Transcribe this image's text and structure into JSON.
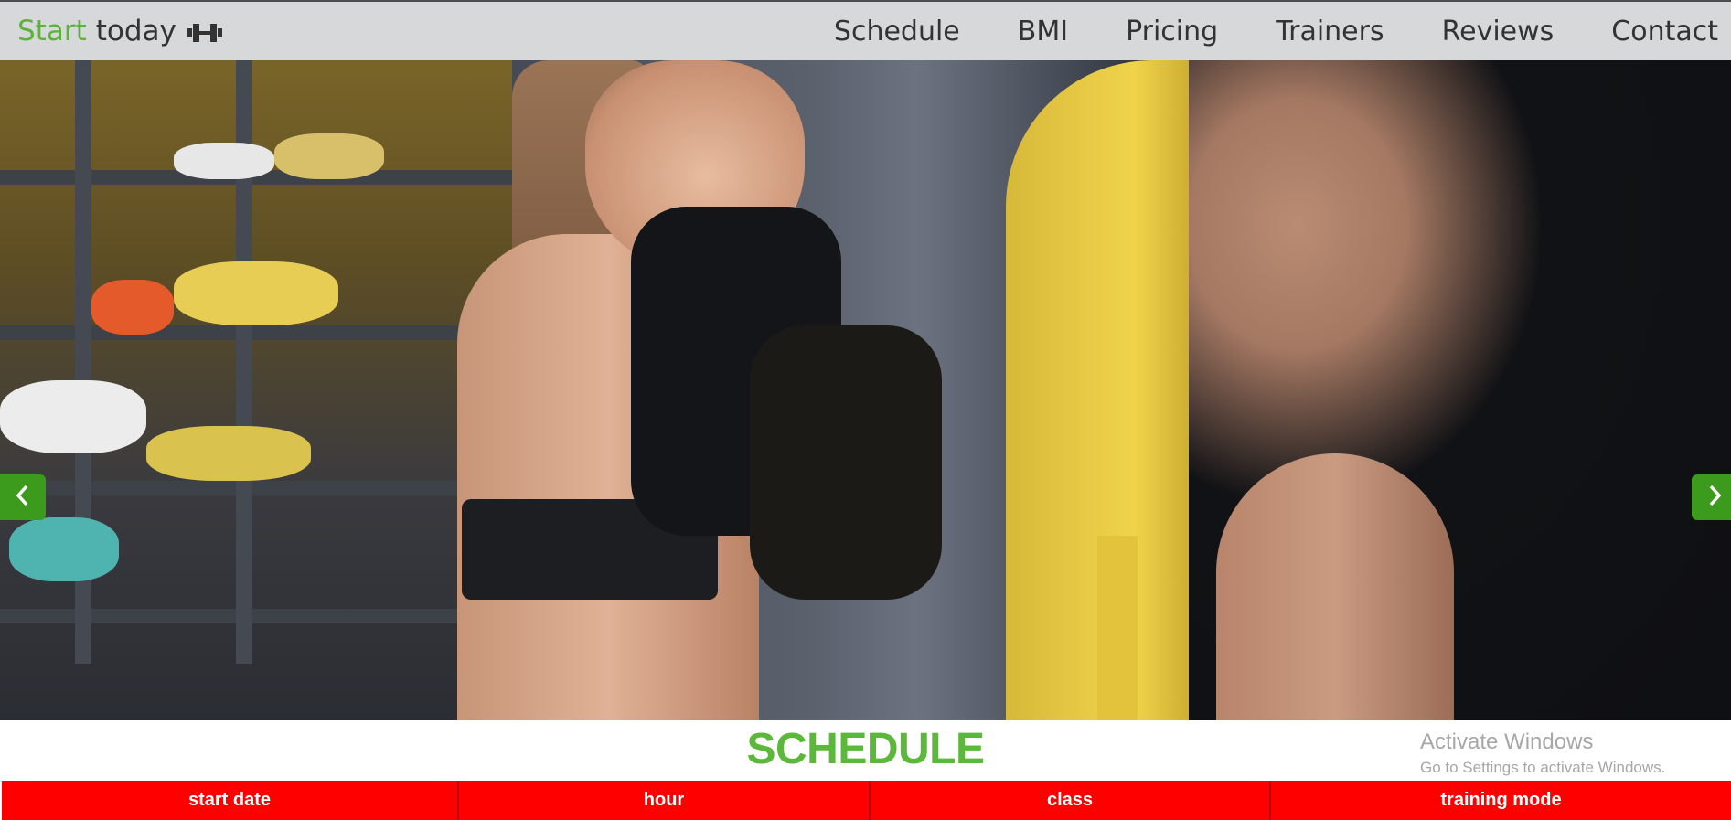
{
  "navbar": {
    "brand_accent": "Start",
    "brand_rest": "today",
    "brand_icon": "dumbbell-icon",
    "links": [
      "Schedule",
      "BMI",
      "Pricing",
      "Trainers",
      "Reviews",
      "Contact"
    ]
  },
  "carousel": {
    "image_description": "woman boxing with trainer holding punching bag",
    "slide_count": 5,
    "active_slide": 1,
    "prev_icon": "chevron-left-icon",
    "next_icon": "chevron-right-icon"
  },
  "schedule": {
    "title": "SCHEDULE",
    "columns": [
      "start date",
      "hour",
      "class",
      "training mode"
    ]
  },
  "watermark": {
    "line1": "Activate Windows",
    "line2": "Go to Settings to activate Windows."
  },
  "colors": {
    "accent_green": "#5cb83a",
    "button_green": "#3c9a1c",
    "table_header_red": "#fe0000",
    "navbar_bg": "#d7d8da"
  }
}
